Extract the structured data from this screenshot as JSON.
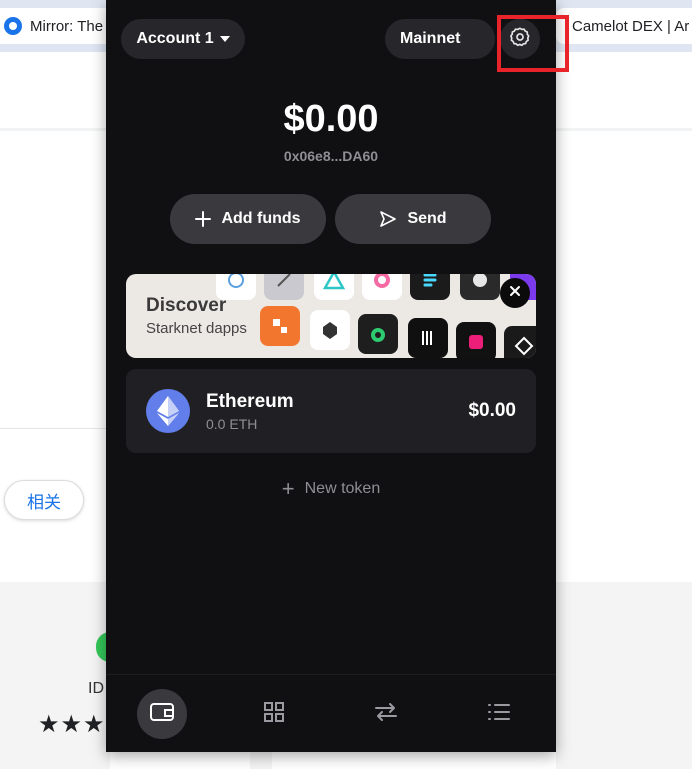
{
  "background": {
    "bookmark_left": "Mirror: The",
    "bookmark_right": "Camelot DEX | Ar",
    "chip_label": "相关",
    "card_text": "ID",
    "rating_stars": "★★★"
  },
  "wallet": {
    "account_label": "Account 1",
    "network_label": "Mainnet",
    "balance": "$0.00",
    "address": "0x06e8...DA60",
    "actions": {
      "add_funds": "Add funds",
      "send": "Send"
    },
    "discover": {
      "title": "Discover",
      "subtitle": "Starknet dapps"
    },
    "token": {
      "name": "Ethereum",
      "amount": "0.0 ETH",
      "value": "$0.00"
    },
    "new_token_label": "New token",
    "nav": [
      "wallet-icon",
      "grid-icon",
      "swap-icon",
      "list-icon"
    ],
    "accent_highlight": "#e8232a"
  }
}
